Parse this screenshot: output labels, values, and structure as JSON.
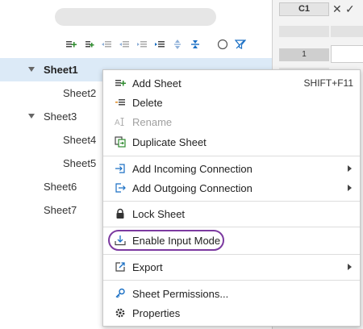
{
  "grid": {
    "cell_ref": "C1",
    "cancel_glyph": "✕",
    "confirm_glyph": "✓",
    "row_number": "1"
  },
  "tree": {
    "items": [
      {
        "label": "Sheet1",
        "level": 0,
        "expanded": true,
        "selected": true
      },
      {
        "label": "Sheet2",
        "level": 1
      },
      {
        "label": "Sheet3",
        "level": 0,
        "expanded": true
      },
      {
        "label": "Sheet4",
        "level": 1
      },
      {
        "label": "Sheet5",
        "level": 1
      },
      {
        "label": "Sheet6",
        "level": 0
      },
      {
        "label": "Sheet7",
        "level": 0
      }
    ]
  },
  "context_menu": {
    "add_sheet": "Add Sheet",
    "add_sheet_shortcut": "SHIFT+F11",
    "delete": "Delete",
    "rename": "Rename",
    "duplicate_sheet": "Duplicate Sheet",
    "add_incoming_connection": "Add Incoming Connection",
    "add_outgoing_connection": "Add Outgoing Connection",
    "lock_sheet": "Lock Sheet",
    "enable_input_mode": "Enable Input Mode",
    "export": "Export",
    "sheet_permissions": "Sheet Permissions...",
    "properties": "Properties"
  },
  "colors": {
    "accent_green": "#2e8b2e",
    "accent_blue": "#1a6fc4",
    "highlight_ring": "#7c3aa0",
    "selection": "#dceaf7"
  },
  "icons": {
    "toolbar": [
      "add-sheet-icon",
      "add-child-sheet-icon",
      "outdent-icon",
      "outdent-left-icon",
      "indent-icon",
      "indent-right-icon",
      "move-updown-icon",
      "collapse-icon",
      "circle-icon",
      "filter-icon"
    ],
    "menu": [
      "add-sheet-icon",
      "delete-icon",
      "rename-icon",
      "duplicate-icon",
      "incoming-connection-icon",
      "outgoing-connection-icon",
      "lock-icon",
      "input-mode-icon",
      "export-icon",
      "permissions-icon",
      "gear-icon"
    ]
  }
}
